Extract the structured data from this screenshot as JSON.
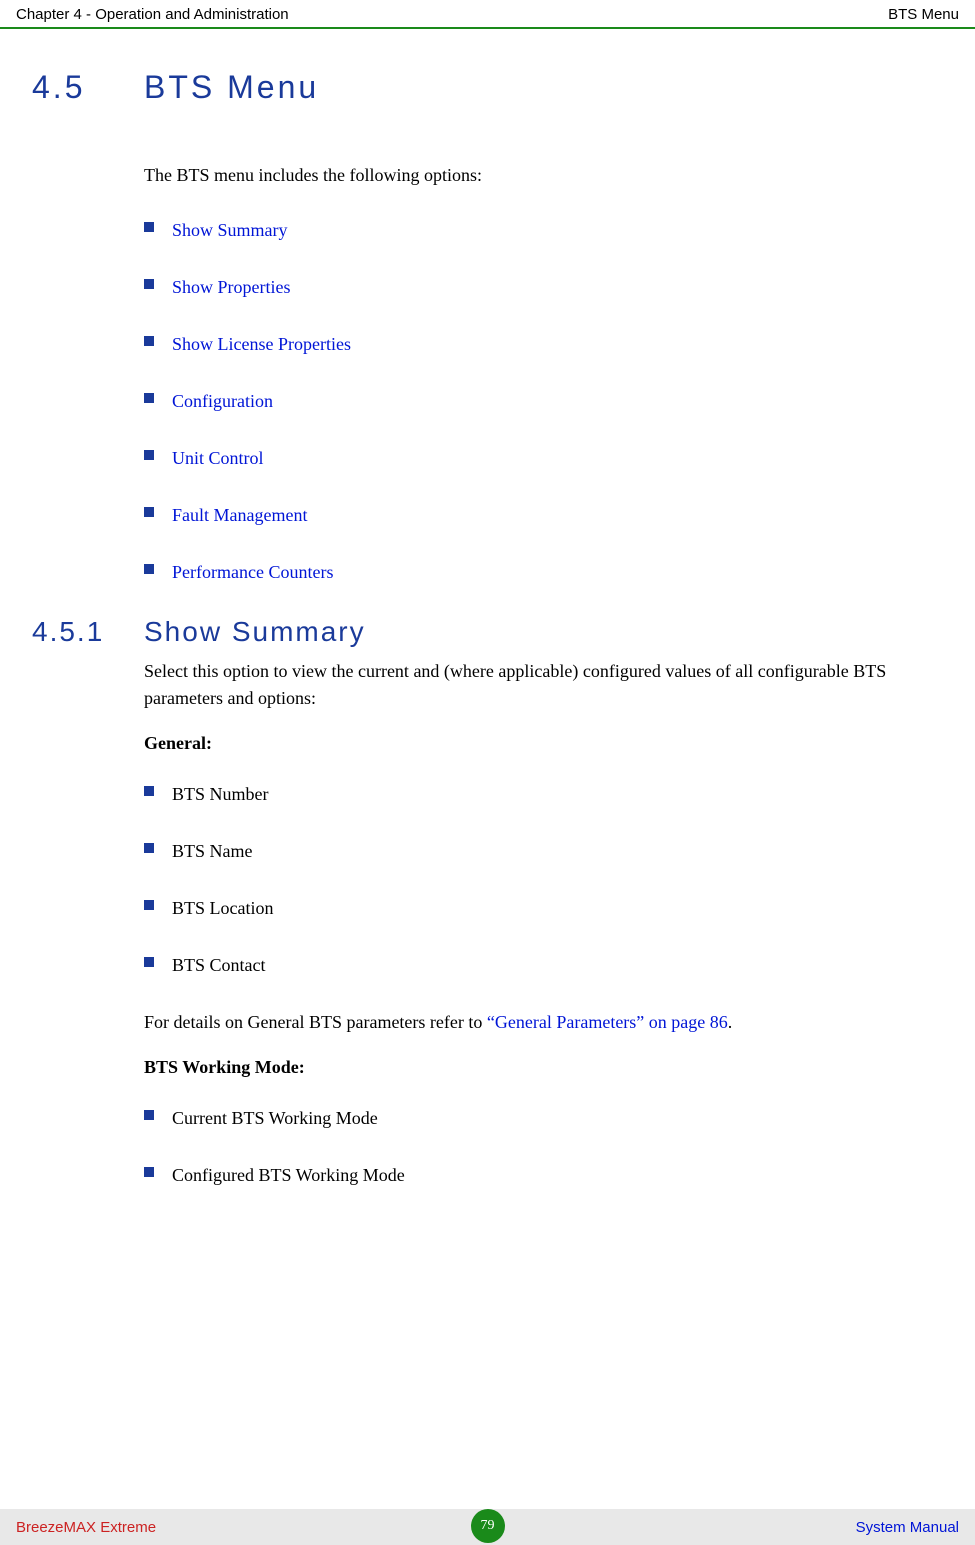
{
  "header": {
    "left": "Chapter 4 - Operation and Administration",
    "right": "BTS Menu"
  },
  "section45": {
    "number": "4.5",
    "title": "BTS Menu",
    "intro": "The BTS menu includes the following options:",
    "options": [
      "Show Summary",
      "Show Properties",
      "Show License Properties",
      "Configuration",
      "Unit Control",
      "Fault Management",
      "Performance Counters"
    ]
  },
  "section451": {
    "number": "4.5.1",
    "title": "Show Summary",
    "intro": "Select this option to view the current and (where applicable) configured values of all configurable BTS parameters and options:",
    "general_heading": "General",
    "general_colon": ":",
    "general_items": [
      "BTS Number",
      "BTS Name",
      "BTS Location",
      "BTS Contact"
    ],
    "general_ref_prefix": "For details on General BTS parameters refer to ",
    "general_ref_link": "“General Parameters” on page 86",
    "general_ref_suffix": ".",
    "working_heading": "BTS Working Mode",
    "working_colon": ":",
    "working_items": [
      "Current BTS Working Mode",
      "Configured BTS Working Mode"
    ]
  },
  "footer": {
    "left": "BreezeMAX Extreme",
    "page": "79",
    "right": "System Manual"
  }
}
